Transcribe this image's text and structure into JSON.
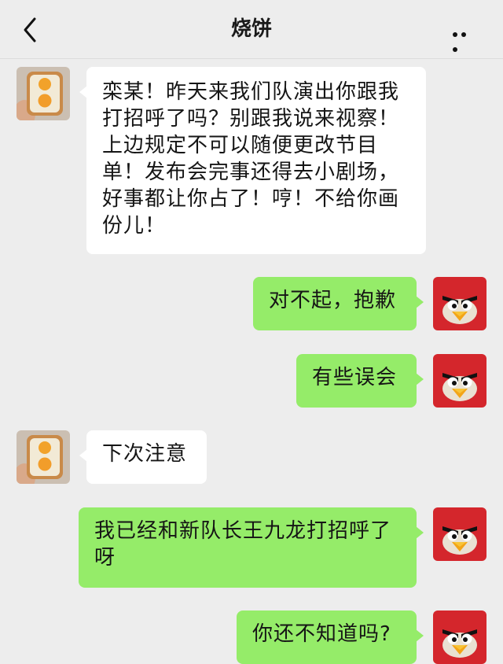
{
  "header": {
    "title": "烧饼",
    "back_icon": "chevron-left-icon",
    "more_icon": "more-dots-icon"
  },
  "colors": {
    "background": "#ededed",
    "incoming_bubble": "#ffffff",
    "outgoing_bubble": "#95ec69"
  },
  "messages": [
    {
      "sender": "other",
      "avatar": "toast-egg-avatar",
      "text": "栾某！昨天来我们队演出你跟我\n打招呼了吗？别跟我说来视察！\n上边规定不可以随便更改节目\n单！发布会完事还得去小剧场，\n好事都让你占了！哼！不给你画\n份儿！"
    },
    {
      "sender": "me",
      "avatar": "angry-bird-avatar",
      "text": "对不起，抱歉"
    },
    {
      "sender": "me",
      "avatar": "angry-bird-avatar",
      "text": "有些误会"
    },
    {
      "sender": "other",
      "avatar": "toast-egg-avatar",
      "text": "下次注意"
    },
    {
      "sender": "me",
      "avatar": "angry-bird-avatar",
      "text": "我已经和新队长王九龙打招呼了\n呀"
    },
    {
      "sender": "me",
      "avatar": "angry-bird-avatar",
      "text": "你还不知道吗?"
    }
  ]
}
